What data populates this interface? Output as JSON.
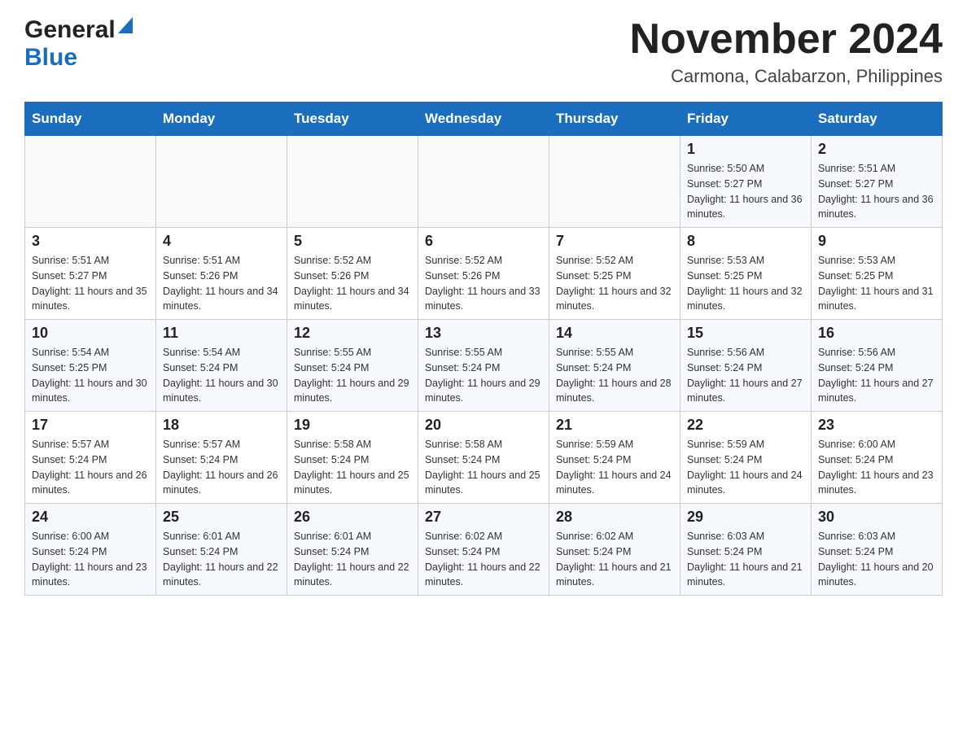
{
  "header": {
    "logo_general": "General",
    "logo_blue": "Blue",
    "title": "November 2024",
    "subtitle": "Carmona, Calabarzon, Philippines"
  },
  "days_of_week": [
    "Sunday",
    "Monday",
    "Tuesday",
    "Wednesday",
    "Thursday",
    "Friday",
    "Saturday"
  ],
  "weeks": [
    [
      {
        "day": "",
        "info": ""
      },
      {
        "day": "",
        "info": ""
      },
      {
        "day": "",
        "info": ""
      },
      {
        "day": "",
        "info": ""
      },
      {
        "day": "",
        "info": ""
      },
      {
        "day": "1",
        "info": "Sunrise: 5:50 AM\nSunset: 5:27 PM\nDaylight: 11 hours and 36 minutes."
      },
      {
        "day": "2",
        "info": "Sunrise: 5:51 AM\nSunset: 5:27 PM\nDaylight: 11 hours and 36 minutes."
      }
    ],
    [
      {
        "day": "3",
        "info": "Sunrise: 5:51 AM\nSunset: 5:27 PM\nDaylight: 11 hours and 35 minutes."
      },
      {
        "day": "4",
        "info": "Sunrise: 5:51 AM\nSunset: 5:26 PM\nDaylight: 11 hours and 34 minutes."
      },
      {
        "day": "5",
        "info": "Sunrise: 5:52 AM\nSunset: 5:26 PM\nDaylight: 11 hours and 34 minutes."
      },
      {
        "day": "6",
        "info": "Sunrise: 5:52 AM\nSunset: 5:26 PM\nDaylight: 11 hours and 33 minutes."
      },
      {
        "day": "7",
        "info": "Sunrise: 5:52 AM\nSunset: 5:25 PM\nDaylight: 11 hours and 32 minutes."
      },
      {
        "day": "8",
        "info": "Sunrise: 5:53 AM\nSunset: 5:25 PM\nDaylight: 11 hours and 32 minutes."
      },
      {
        "day": "9",
        "info": "Sunrise: 5:53 AM\nSunset: 5:25 PM\nDaylight: 11 hours and 31 minutes."
      }
    ],
    [
      {
        "day": "10",
        "info": "Sunrise: 5:54 AM\nSunset: 5:25 PM\nDaylight: 11 hours and 30 minutes."
      },
      {
        "day": "11",
        "info": "Sunrise: 5:54 AM\nSunset: 5:24 PM\nDaylight: 11 hours and 30 minutes."
      },
      {
        "day": "12",
        "info": "Sunrise: 5:55 AM\nSunset: 5:24 PM\nDaylight: 11 hours and 29 minutes."
      },
      {
        "day": "13",
        "info": "Sunrise: 5:55 AM\nSunset: 5:24 PM\nDaylight: 11 hours and 29 minutes."
      },
      {
        "day": "14",
        "info": "Sunrise: 5:55 AM\nSunset: 5:24 PM\nDaylight: 11 hours and 28 minutes."
      },
      {
        "day": "15",
        "info": "Sunrise: 5:56 AM\nSunset: 5:24 PM\nDaylight: 11 hours and 27 minutes."
      },
      {
        "day": "16",
        "info": "Sunrise: 5:56 AM\nSunset: 5:24 PM\nDaylight: 11 hours and 27 minutes."
      }
    ],
    [
      {
        "day": "17",
        "info": "Sunrise: 5:57 AM\nSunset: 5:24 PM\nDaylight: 11 hours and 26 minutes."
      },
      {
        "day": "18",
        "info": "Sunrise: 5:57 AM\nSunset: 5:24 PM\nDaylight: 11 hours and 26 minutes."
      },
      {
        "day": "19",
        "info": "Sunrise: 5:58 AM\nSunset: 5:24 PM\nDaylight: 11 hours and 25 minutes."
      },
      {
        "day": "20",
        "info": "Sunrise: 5:58 AM\nSunset: 5:24 PM\nDaylight: 11 hours and 25 minutes."
      },
      {
        "day": "21",
        "info": "Sunrise: 5:59 AM\nSunset: 5:24 PM\nDaylight: 11 hours and 24 minutes."
      },
      {
        "day": "22",
        "info": "Sunrise: 5:59 AM\nSunset: 5:24 PM\nDaylight: 11 hours and 24 minutes."
      },
      {
        "day": "23",
        "info": "Sunrise: 6:00 AM\nSunset: 5:24 PM\nDaylight: 11 hours and 23 minutes."
      }
    ],
    [
      {
        "day": "24",
        "info": "Sunrise: 6:00 AM\nSunset: 5:24 PM\nDaylight: 11 hours and 23 minutes."
      },
      {
        "day": "25",
        "info": "Sunrise: 6:01 AM\nSunset: 5:24 PM\nDaylight: 11 hours and 22 minutes."
      },
      {
        "day": "26",
        "info": "Sunrise: 6:01 AM\nSunset: 5:24 PM\nDaylight: 11 hours and 22 minutes."
      },
      {
        "day": "27",
        "info": "Sunrise: 6:02 AM\nSunset: 5:24 PM\nDaylight: 11 hours and 22 minutes."
      },
      {
        "day": "28",
        "info": "Sunrise: 6:02 AM\nSunset: 5:24 PM\nDaylight: 11 hours and 21 minutes."
      },
      {
        "day": "29",
        "info": "Sunrise: 6:03 AM\nSunset: 5:24 PM\nDaylight: 11 hours and 21 minutes."
      },
      {
        "day": "30",
        "info": "Sunrise: 6:03 AM\nSunset: 5:24 PM\nDaylight: 11 hours and 20 minutes."
      }
    ]
  ]
}
